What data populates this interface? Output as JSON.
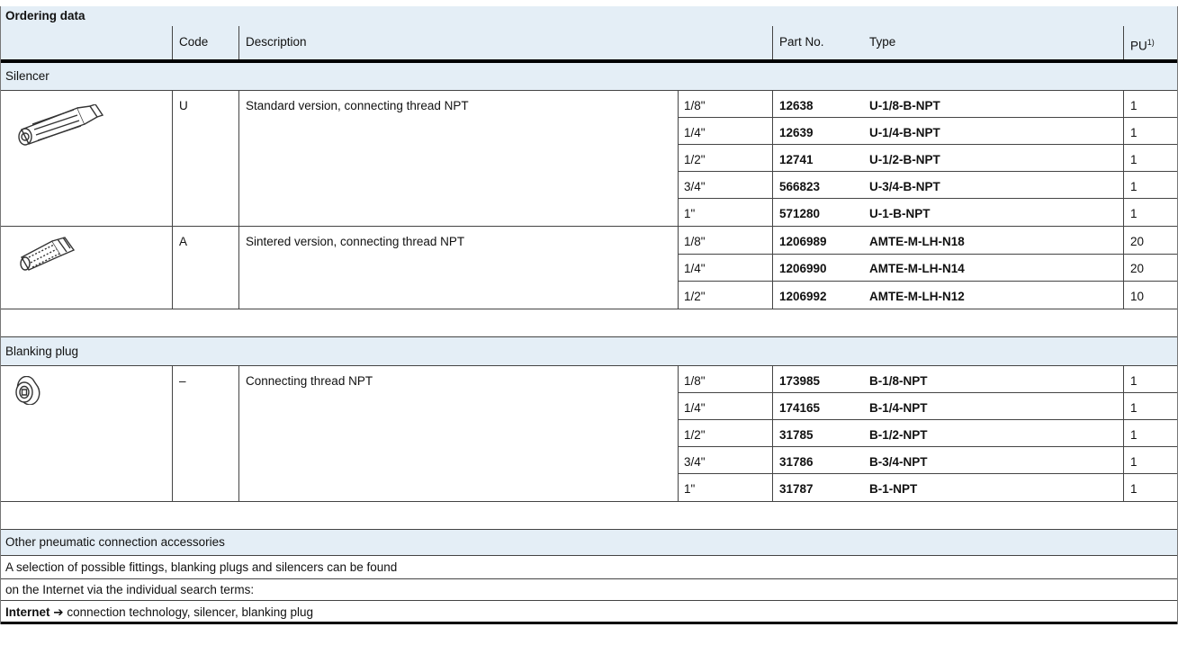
{
  "title": "Ordering data",
  "headers": {
    "code": "Code",
    "description": "Description",
    "part_no": "Part No.",
    "type": "Type",
    "pu": "PU",
    "pu_sup": "1)"
  },
  "sections": [
    {
      "name": "Silencer",
      "groups": [
        {
          "icon": "silencer-standard-icon",
          "code": "U",
          "description": "Standard version, connecting thread NPT",
          "rows": [
            {
              "size": "1/8\"",
              "part_no": "12638",
              "type": "U-1/8-B-NPT",
              "pu": "1"
            },
            {
              "size": "1/4\"",
              "part_no": "12639",
              "type": "U-1/4-B-NPT",
              "pu": "1"
            },
            {
              "size": "1/2\"",
              "part_no": "12741",
              "type": "U-1/2-B-NPT",
              "pu": "1"
            },
            {
              "size": "3/4\"",
              "part_no": "566823",
              "type": "U-3/4-B-NPT",
              "pu": "1"
            },
            {
              "size": "1\"",
              "part_no": "571280",
              "type": "U-1-B-NPT",
              "pu": "1"
            }
          ]
        },
        {
          "icon": "silencer-sintered-icon",
          "code": "A",
          "description": "Sintered version, connecting thread NPT",
          "rows": [
            {
              "size": "1/8\"",
              "part_no": "1206989",
              "type": "AMTE-M-LH-N18",
              "pu": "20"
            },
            {
              "size": "1/4\"",
              "part_no": "1206990",
              "type": "AMTE-M-LH-N14",
              "pu": "20"
            },
            {
              "size": "1/2\"",
              "part_no": "1206992",
              "type": "AMTE-M-LH-N12",
              "pu": "10"
            }
          ]
        }
      ]
    },
    {
      "name": "Blanking plug",
      "groups": [
        {
          "icon": "blanking-plug-icon",
          "code": "–",
          "description": "Connecting thread NPT",
          "rows": [
            {
              "size": "1/8\"",
              "part_no": "173985",
              "type": "B-1/8-NPT",
              "pu": "1"
            },
            {
              "size": "1/4\"",
              "part_no": "174165",
              "type": "B-1/4-NPT",
              "pu": "1"
            },
            {
              "size": "1/2\"",
              "part_no": "31785",
              "type": "B-1/2-NPT",
              "pu": "1"
            },
            {
              "size": "3/4\"",
              "part_no": "31786",
              "type": "B-3/4-NPT",
              "pu": "1"
            },
            {
              "size": "1\"",
              "part_no": "31787",
              "type": "B-1-NPT",
              "pu": "1"
            }
          ]
        }
      ]
    }
  ],
  "accessories": {
    "heading": "Other pneumatic connection accessories",
    "line1": "A selection of possible fittings, blanking plugs and silencers can be found",
    "line2": "on the Internet via the individual search terms:",
    "internet_label": "Internet",
    "arrow": "➔",
    "internet_terms": "connection technology, silencer, blanking plug"
  },
  "colors": {
    "band": "#e4eef6",
    "line": "#444444"
  }
}
